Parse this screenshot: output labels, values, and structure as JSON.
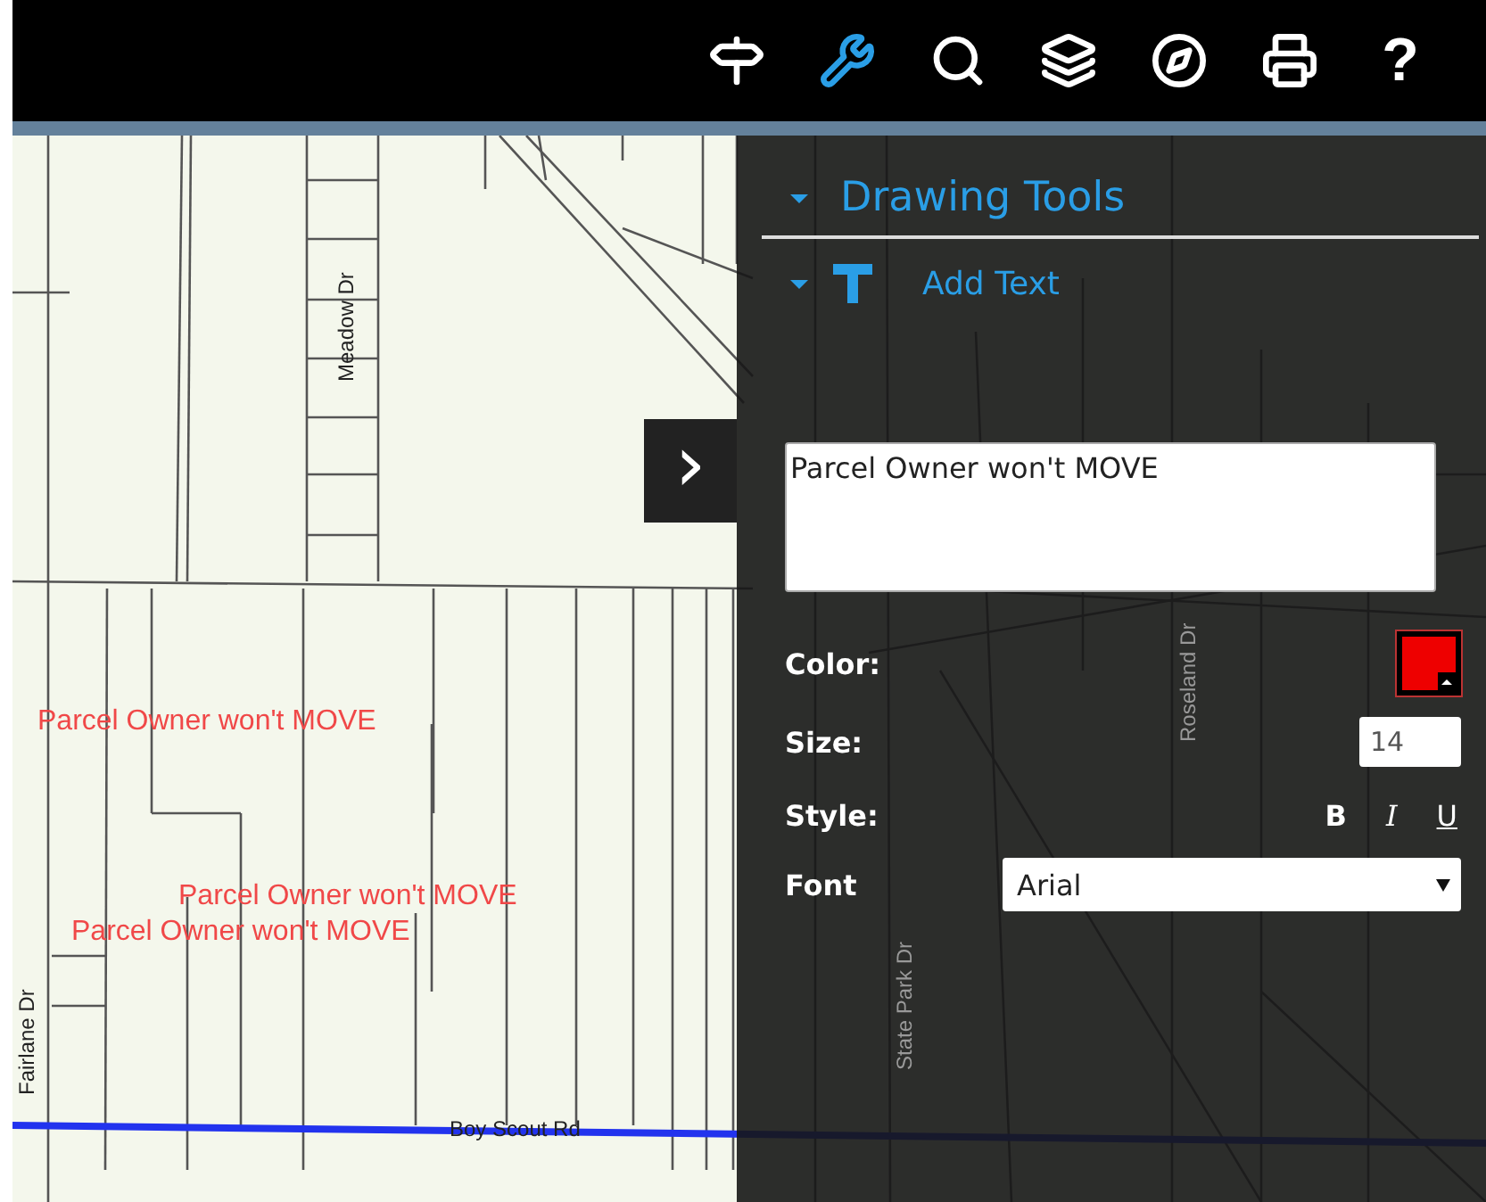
{
  "toolbar": {
    "tools": [
      {
        "kind": "signpost",
        "selected": false
      },
      {
        "kind": "wrench",
        "selected": true
      },
      {
        "kind": "search",
        "selected": false
      },
      {
        "kind": "layers",
        "selected": false
      },
      {
        "kind": "compass",
        "selected": false
      },
      {
        "kind": "printer",
        "selected": false
      },
      {
        "kind": "help",
        "label": "?",
        "selected": false
      }
    ]
  },
  "map": {
    "labels": [
      {
        "text": "Meadow Dr",
        "kind": "vertical_street"
      },
      {
        "text": "Parcel Owner won't MOVE",
        "kind": "annotation"
      },
      {
        "text": "Parcel Owner won't MOVE",
        "kind": "annotation"
      },
      {
        "text": "Parcel Owner won't MOVE",
        "kind": "annotation"
      },
      {
        "text": "Fairlane Dr",
        "kind": "vertical_street"
      },
      {
        "text": "Boy Scout Rd",
        "kind": "street"
      },
      {
        "text": "Roseland Dr",
        "kind": "vertical_street"
      },
      {
        "text": "State Park Dr",
        "kind": "vertical_street"
      }
    ]
  },
  "collapse_button": {
    "label": "›"
  },
  "panel": {
    "title": "Drawing Tools",
    "expanded": true,
    "section": {
      "title": "Add Text",
      "expanded": true
    },
    "text_value": "Parcel Owner won't MOVE",
    "color": {
      "label": "Color:",
      "color": "#ee0000"
    },
    "size": {
      "label": "Size:",
      "value": "14"
    },
    "style": {
      "label": "Style:",
      "options": [
        {
          "kind": "bold",
          "label": "B",
          "selected": false
        },
        {
          "kind": "italic",
          "label": "I",
          "selected": false
        },
        {
          "kind": "underline",
          "label": "U",
          "selected": false
        }
      ]
    },
    "font": {
      "label": "Font",
      "value": "Arial"
    }
  }
}
